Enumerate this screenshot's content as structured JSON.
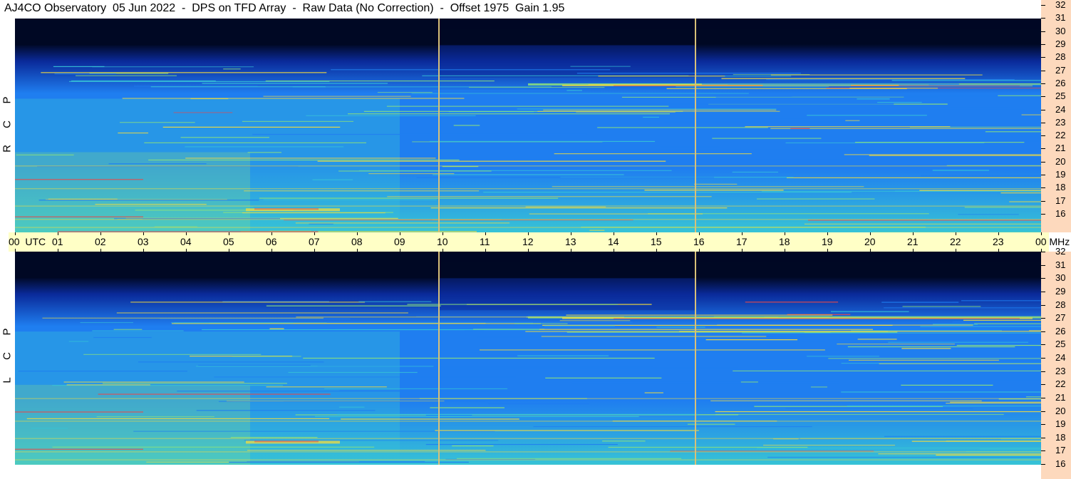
{
  "title": "AJ4CO Observatory  05 Jun 2022  -  DPS on TFD Array  -  Raw Data (No Correction)  -  Offset 1975  Gain 1.95",
  "panels": {
    "top": {
      "letters": [
        "P",
        "C",
        "R"
      ]
    },
    "bottom": {
      "letters": [
        "P",
        "C",
        "L"
      ]
    }
  },
  "time_axis": {
    "first_label": "00  UTC",
    "labels": [
      "01",
      "02",
      "03",
      "04",
      "05",
      "06",
      "07",
      "08",
      "09",
      "10",
      "11",
      "12",
      "13",
      "14",
      "15",
      "16",
      "17",
      "18",
      "19",
      "20",
      "21",
      "22",
      "23"
    ],
    "last_label": "00 MHz"
  },
  "freq_axis": {
    "labels": [
      "32",
      "31",
      "30",
      "29",
      "28",
      "27",
      "26",
      "25",
      "24",
      "23",
      "22",
      "21",
      "20",
      "19",
      "18",
      "17",
      "16"
    ]
  },
  "colors": {
    "background_dark": "#000824",
    "low": "#0a2a9a",
    "mid": "#1f7ef0",
    "high": "#37c3d6",
    "band_green": "#8ee27a",
    "band_yellow": "#f4dc3c",
    "band_red": "#e8484a",
    "time_band": "#ffffc6",
    "axis_strip": "#fdd9bd",
    "marker": "#d8c078"
  },
  "chart_data": {
    "type": "heatmap",
    "title": "AJ4CO Observatory  05 Jun 2022  -  DPS on TFD Array  -  Raw Data (No Correction)  -  Offset 1975  Gain 1.95",
    "xlabel": "UTC",
    "ylabel": "MHz",
    "xlim": [
      0,
      24
    ],
    "ylim": [
      16,
      32
    ],
    "x_ticks": [
      "00",
      "01",
      "02",
      "03",
      "04",
      "05",
      "06",
      "07",
      "08",
      "09",
      "10",
      "11",
      "12",
      "13",
      "14",
      "15",
      "16",
      "17",
      "18",
      "19",
      "20",
      "21",
      "22",
      "23",
      "00"
    ],
    "y_ticks": [
      16,
      17,
      18,
      19,
      20,
      21,
      22,
      23,
      24,
      25,
      26,
      27,
      28,
      29,
      30,
      31,
      32
    ],
    "panels": [
      "RCP",
      "LCP"
    ],
    "markers_utc": [
      9.9,
      15.9
    ],
    "strong_bands_mhz": [
      27.0,
      26.9,
      17.2,
      17.8
    ]
  }
}
